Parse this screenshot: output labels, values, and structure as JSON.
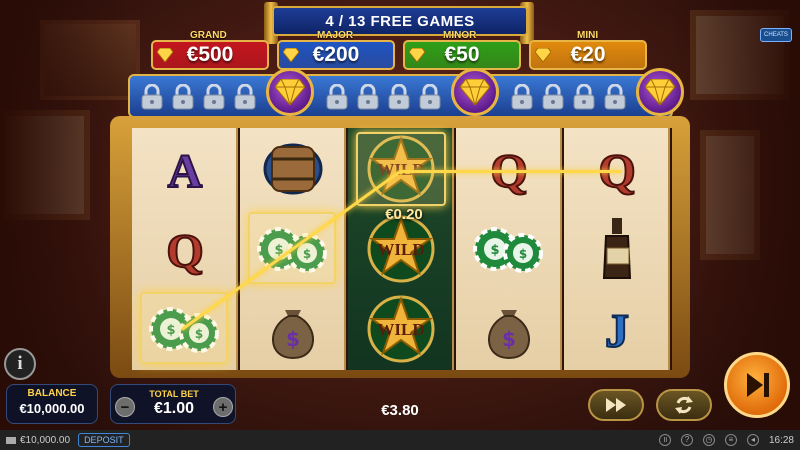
{
  "header": {
    "free_games": "4 / 13 FREE GAMES",
    "cheats_label": "CHEATS"
  },
  "jackpots": [
    {
      "label": "GRAND",
      "value": "€500",
      "color": "#c4161f"
    },
    {
      "label": "MAJOR",
      "value": "€200",
      "color": "#1f55c2"
    },
    {
      "label": "MINOR",
      "value": "€50",
      "color": "#2ea019"
    },
    {
      "label": "MINI",
      "value": "€20",
      "color": "#e08a0d"
    }
  ],
  "lock_groups": [
    {
      "locks": 4,
      "icon": "diamond-icon"
    },
    {
      "locks": 4,
      "icon": "diamond-icon"
    },
    {
      "locks": 4,
      "icon": "diamond-icon"
    }
  ],
  "reels": [
    {
      "symbols": [
        "letter-a",
        "letter-q",
        "poker-chips"
      ]
    },
    {
      "symbols": [
        "barrel",
        "poker-chips",
        "money-bag"
      ]
    },
    {
      "symbols": [
        "wild-sheriff-star",
        "wild-sheriff-star",
        "wild-sheriff-star"
      ]
    },
    {
      "symbols": [
        "letter-q",
        "poker-chips",
        "money-bag"
      ]
    },
    {
      "symbols": [
        "letter-q",
        "whiskey-bottle",
        "letter-j"
      ]
    }
  ],
  "reel_text": {
    "a": "A",
    "q": "Q",
    "j": "J",
    "wild": "WILD"
  },
  "line_win": "€0.20",
  "controls": {
    "info_label": "i",
    "balance_label": "BALANCE",
    "balance_value": "€10,000.00",
    "total_bet_label": "TOTAL BET",
    "total_bet_value": "€1.00",
    "minus_label": "−",
    "plus_label": "+",
    "total_win": "€3.80",
    "fast_play_icon": "fast-forward-icon",
    "autoplay_icon": "autoplay-icon",
    "spin_icon": "play-skip-icon"
  },
  "status_bar": {
    "balance": "€10,000.00",
    "deposit": "DEPOSIT",
    "time": "16:28"
  },
  "colors": {
    "gold": "#e2b447",
    "panel_blue": "#1b3f8f",
    "spin_orange": "#f08a1a"
  }
}
